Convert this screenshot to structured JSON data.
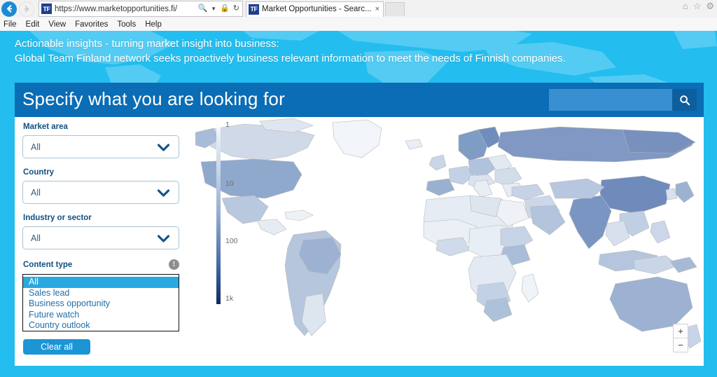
{
  "browser": {
    "back_icon": "back-arrow-icon",
    "forward_icon": "forward-arrow-icon",
    "site_badge": "TF",
    "url": "https://www.marketopportunities.fi/",
    "search_icon": "search-icon",
    "dropdown_icon": "chevron-down-icon",
    "lock_icon": "lock-icon",
    "refresh_icon": "refresh-icon",
    "tab_title": "Market Opportunities - Searc...",
    "tab_close": "×",
    "home_icon": "⌂",
    "favorites_icon": "☆",
    "settings_icon": "⚙",
    "menu": [
      "File",
      "Edit",
      "View",
      "Favorites",
      "Tools",
      "Help"
    ]
  },
  "banner": {
    "line1": "Actionable insights - turning market insight into business:",
    "line2": "Global Team Finland network seeks proactively business relevant information to meet the needs of Finnish companies."
  },
  "panel": {
    "title": "Specify what you are looking for",
    "search": {
      "value": "",
      "placeholder": "",
      "button_icon": "search-icon"
    }
  },
  "filters": {
    "market_area": {
      "label": "Market area",
      "value": "All"
    },
    "country": {
      "label": "Country",
      "value": "All"
    },
    "industry": {
      "label": "Industry or sector",
      "value": "All"
    },
    "content_type": {
      "label": "Content type",
      "info_icon": "info-icon",
      "options": [
        "All",
        "Sales lead",
        "Business opportunity",
        "Future watch",
        "Country outlook"
      ],
      "selected": "All"
    },
    "clear_button": "Clear all"
  },
  "map": {
    "legend": {
      "labels": [
        "1",
        "10",
        "100",
        "1k"
      ],
      "gradient_from": "#ffffff",
      "gradient_to": "#0d2a5c"
    },
    "zoom_in": "+",
    "zoom_out": "−"
  },
  "colors": {
    "banner_cyan": "#23bdef",
    "panel_header_blue": "#0a6db5",
    "accent_blue": "#1b95d6",
    "label_blue": "#11517f"
  }
}
